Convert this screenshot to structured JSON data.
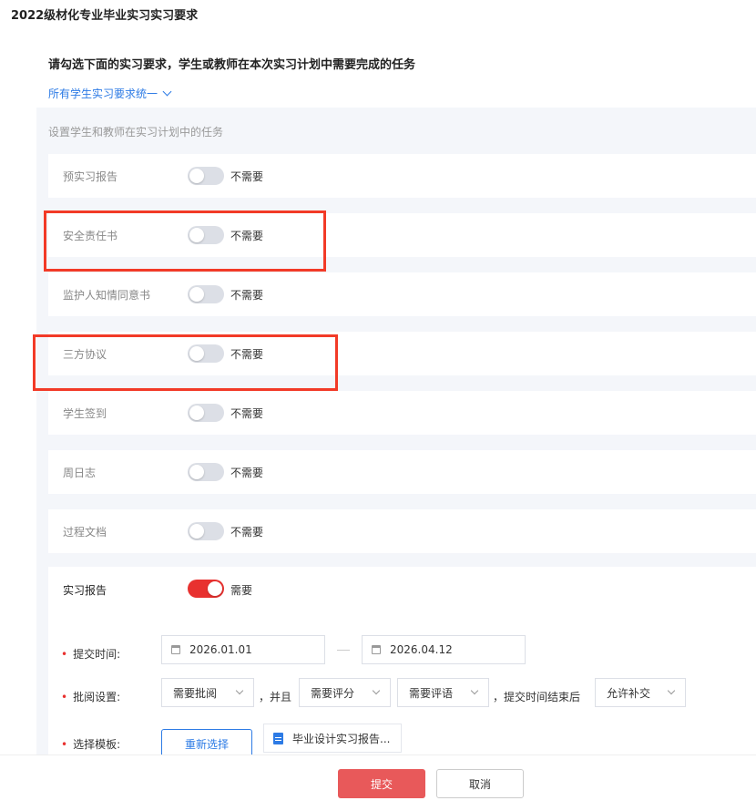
{
  "page": {
    "title": "2022级材化专业毕业实习实习要求"
  },
  "section": {
    "heading": "请勾选下面的实习要求，学生或教师在本次实习计划中需要完成的任务",
    "unify_link": "所有学生实习要求统一"
  },
  "panel": {
    "caption": "设置学生和教师在实习计划中的任务",
    "tasks": [
      {
        "label": "预实习报告",
        "state": "不需要",
        "enabled": false
      },
      {
        "label": "安全责任书",
        "state": "不需要",
        "enabled": false
      },
      {
        "label": "监护人知情同意书",
        "state": "不需要",
        "enabled": false
      },
      {
        "label": "三方协议",
        "state": "不需要",
        "enabled": false
      },
      {
        "label": "学生签到",
        "state": "不需要",
        "enabled": false
      },
      {
        "label": "周日志",
        "state": "不需要",
        "enabled": false
      },
      {
        "label": "过程文档",
        "state": "不需要",
        "enabled": false
      }
    ]
  },
  "report": {
    "label": "实习报告",
    "state": "需要",
    "enabled": true,
    "required_mark": "•",
    "submit_time": {
      "label": "提交时间:",
      "start": "2026.01.01",
      "end": "2026.04.12"
    },
    "review": {
      "label": "批阅设置:",
      "review_select": "需要批阅",
      "conj": "，并且",
      "score_select": "需要评分",
      "comment_select": "需要评语",
      "after_text": "，提交时间结束后",
      "late_select": "允许补交"
    },
    "template": {
      "label": "选择模板:",
      "reselect_button": "重新选择",
      "file_name": "毕业设计实习报告..."
    }
  },
  "footer": {
    "submit_button": "提交",
    "cancel_button": "取消"
  },
  "colors": {
    "accent_red": "#e8312f",
    "link_blue": "#2d7be5",
    "highlight_red": "#f23a27",
    "panel_bg": "#f4f6fa"
  }
}
